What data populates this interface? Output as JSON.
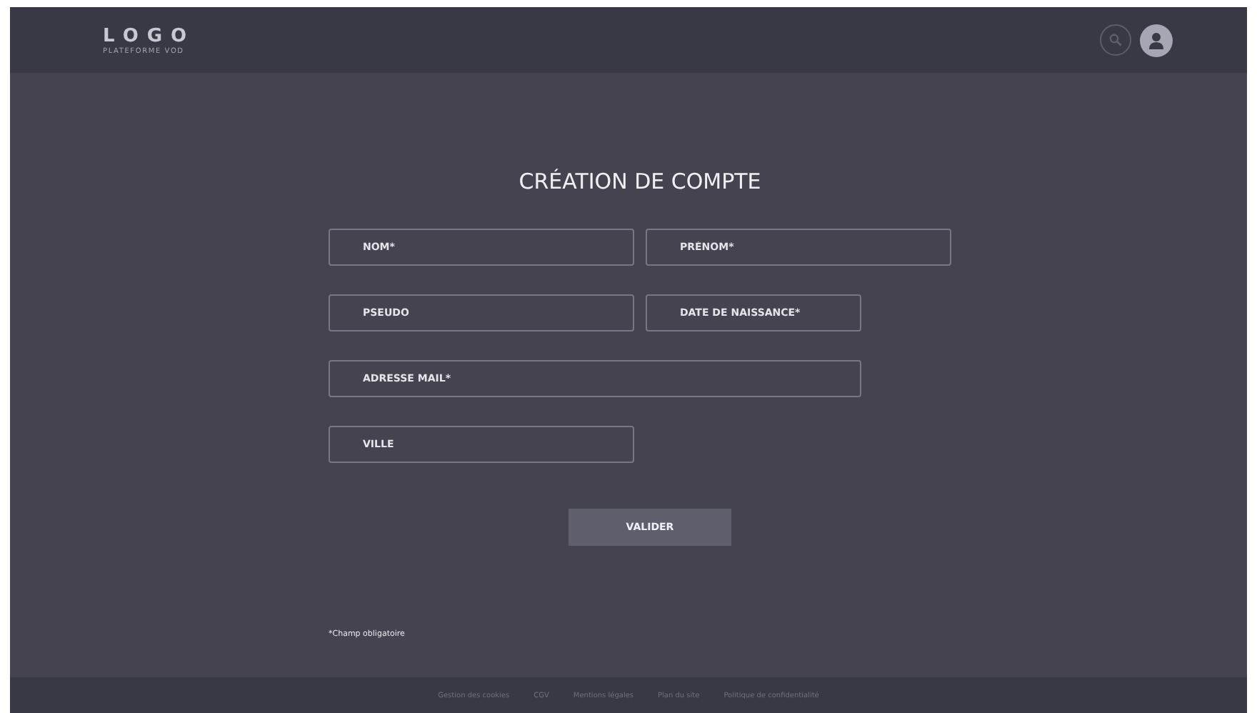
{
  "header": {
    "logo": "LOGO",
    "tagline": "PLATEFORME VOD"
  },
  "title": "CRÉATION DE COMPTE",
  "fields": [
    {
      "placeholder": "NOM*",
      "kind": "half"
    },
    {
      "placeholder": "PRÉNOM*",
      "kind": "half"
    },
    {
      "placeholder": "PSEUDO",
      "kind": "half"
    },
    {
      "placeholder": "DATE DE NAISSANCE*",
      "kind": "short"
    },
    {
      "placeholder": "ADRESSE MAIL*",
      "kind": "wide"
    },
    {
      "placeholder": "VILLE",
      "kind": "half"
    }
  ],
  "submit": "VALIDER",
  "note": "*Champ obligatoire",
  "footer_links": [
    "Gestion des cookies",
    "CGV",
    "Mentions légales",
    "Plan du site",
    "Politique de confidentialité"
  ]
}
